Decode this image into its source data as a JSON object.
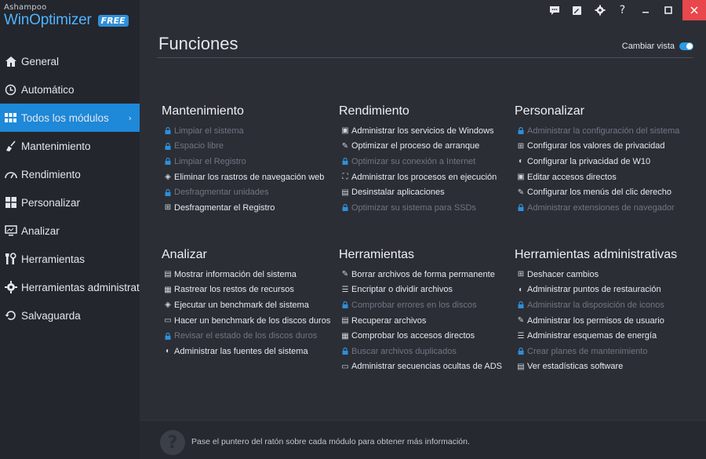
{
  "app": {
    "brand_small": "Ashampoo",
    "brand_name": "WinOptimizer",
    "badge": "FREE"
  },
  "sidebar": {
    "items": [
      {
        "label": "General",
        "icon": "home-icon"
      },
      {
        "label": "Automático",
        "icon": "clock-icon"
      },
      {
        "label": "Todos los módulos",
        "icon": "grid-icon",
        "active": true
      },
      {
        "label": "Mantenimiento",
        "icon": "broom-icon"
      },
      {
        "label": "Rendimiento",
        "icon": "speedometer-icon"
      },
      {
        "label": "Personalizar",
        "icon": "windows-icon"
      },
      {
        "label": "Analizar",
        "icon": "monitor-icon"
      },
      {
        "label": "Herramientas",
        "icon": "tools-icon"
      },
      {
        "label": "Herramientas administrat",
        "icon": "gear-icon"
      },
      {
        "label": "Salvaguarda",
        "icon": "restore-icon"
      }
    ]
  },
  "header": {
    "title": "Funciones",
    "toggle_label": "Cambiar vista"
  },
  "sections": [
    {
      "title": "Mantenimiento",
      "items": [
        {
          "label": "Limpiar el sistema",
          "enabled": false
        },
        {
          "label": "Espacio libre",
          "enabled": false
        },
        {
          "label": "Limpiar el Registro",
          "enabled": false
        },
        {
          "label": "Eliminar los rastros de navegación web",
          "enabled": true
        },
        {
          "label": "Desfragmentar unidades",
          "enabled": false
        },
        {
          "label": "Desfragmentar el Registro",
          "enabled": true
        }
      ]
    },
    {
      "title": "Rendimiento",
      "items": [
        {
          "label": "Administrar los servicios de Windows",
          "enabled": true
        },
        {
          "label": "Optimizar el proceso de arranque",
          "enabled": true
        },
        {
          "label": "Optimizar su conexión a Internet",
          "enabled": false
        },
        {
          "label": "Administrar los procesos en ejecución",
          "enabled": true
        },
        {
          "label": "Desinstalar aplicaciones",
          "enabled": true
        },
        {
          "label": "Optimizar su sistema para SSDs",
          "enabled": false
        }
      ]
    },
    {
      "title": "Personalizar",
      "items": [
        {
          "label": "Administrar la configuración del sistema",
          "enabled": false
        },
        {
          "label": "Configurar los valores de privacidad",
          "enabled": true
        },
        {
          "label": "Configurar la privacidad de W10",
          "enabled": true
        },
        {
          "label": "Editar accesos directos",
          "enabled": true
        },
        {
          "label": "Configurar los menús del clic derecho",
          "enabled": true
        },
        {
          "label": "Administrar extensiones de navegador",
          "enabled": false
        }
      ]
    },
    {
      "title": "Analizar",
      "items": [
        {
          "label": "Mostrar información del sistema",
          "enabled": true
        },
        {
          "label": "Rastrear los restos de recursos",
          "enabled": true
        },
        {
          "label": "Ejecutar un benchmark del sistema",
          "enabled": true
        },
        {
          "label": "Hacer un benchmark de los discos duros",
          "enabled": true
        },
        {
          "label": "Revisar el estado de los discos duros",
          "enabled": false
        },
        {
          "label": "Administrar las fuentes del sistema",
          "enabled": true
        }
      ]
    },
    {
      "title": "Herramientas",
      "items": [
        {
          "label": "Borrar archivos de forma permanente",
          "enabled": true
        },
        {
          "label": "Encriptar o dividir archivos",
          "enabled": true
        },
        {
          "label": "Comprobar errores en los discos",
          "enabled": false
        },
        {
          "label": "Recuperar archivos",
          "enabled": true
        },
        {
          "label": "Comprobar los accesos directos",
          "enabled": true
        },
        {
          "label": "Buscar archivos duplicados",
          "enabled": false
        },
        {
          "label": "Administrar secuencias ocultas de ADS",
          "enabled": true
        }
      ]
    },
    {
      "title": "Herramientas administrativas",
      "items": [
        {
          "label": "Deshacer cambios",
          "enabled": true
        },
        {
          "label": "Administrar puntos de restauración",
          "enabled": true
        },
        {
          "label": "Administrar la disposición de iconos",
          "enabled": false
        },
        {
          "label": "Administrar los permisos de usuario",
          "enabled": true
        },
        {
          "label": "Administrar esquemas de energía",
          "enabled": true
        },
        {
          "label": "Crear planes de mantenimiento",
          "enabled": false
        },
        {
          "label": "Ver estadísticas software",
          "enabled": true
        }
      ]
    }
  ],
  "footer": {
    "help_glyph": "?",
    "hint": "Pase el puntero del ratón sobre cada módulo para obtener más información."
  },
  "colors": {
    "accent": "#1e88d9",
    "background": "#2b2e35",
    "sidebar": "#23262c",
    "close": "#e8474b",
    "disabled_text": "#6f7682"
  }
}
